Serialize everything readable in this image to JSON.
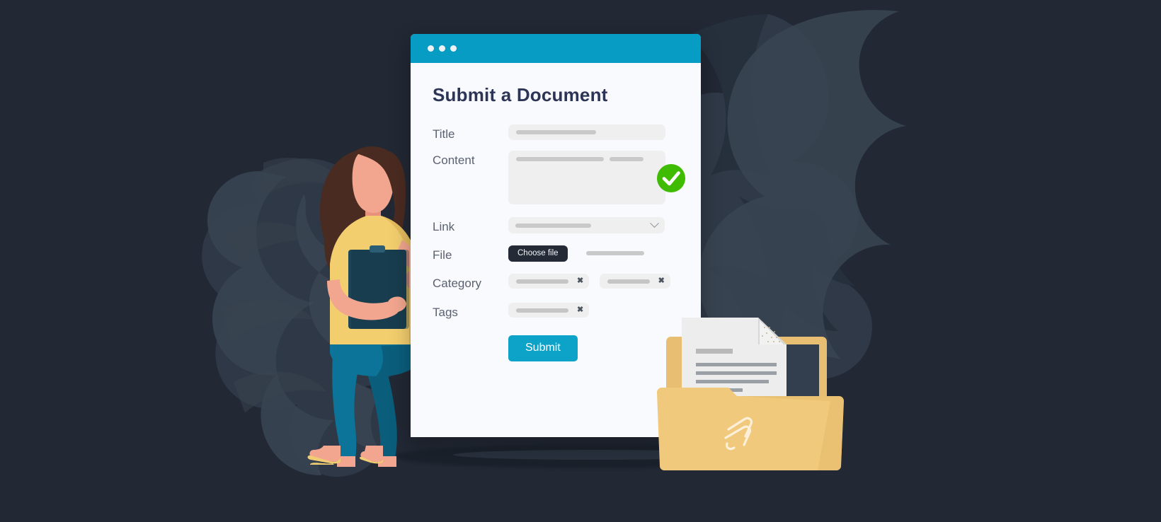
{
  "page": {
    "background_color": "#222834",
    "illustration_names": [
      "woman-with-clipboard",
      "document-folder",
      "monstera-leaf-left",
      "monstera-leaf-right"
    ]
  },
  "window": {
    "titlebar": {
      "color": "#069CC4",
      "dots": [
        "dot-1",
        "dot-2",
        "dot-3"
      ]
    },
    "background_color": "#F9FAFD",
    "heading": "Submit a Document"
  },
  "form": {
    "fields": [
      {
        "id": "title",
        "label": "Title",
        "type": "text",
        "value": "",
        "placeholder": ""
      },
      {
        "id": "content",
        "label": "Content",
        "type": "textarea",
        "value": "",
        "placeholder": ""
      },
      {
        "id": "link",
        "label": "Link",
        "type": "select",
        "value": "",
        "placeholder": ""
      },
      {
        "id": "file",
        "label": "File",
        "type": "file",
        "value": "",
        "placeholder": ""
      },
      {
        "id": "category",
        "label": "Category",
        "type": "tags",
        "value": "",
        "placeholder": ""
      },
      {
        "id": "tags",
        "label": "Tags",
        "type": "tags",
        "value": "",
        "placeholder": ""
      }
    ],
    "file_button_label": "Choose file",
    "category_chips": [
      {
        "remove_label": "✖"
      },
      {
        "remove_label": "✖"
      }
    ],
    "tags_chips": [
      {
        "remove_label": "✖"
      }
    ],
    "submit_label": "Submit",
    "submit_color": "#0DA2C8",
    "validation": {
      "content": {
        "state": "valid",
        "icon": "check-circle-icon",
        "color": "#3FBC00"
      }
    }
  },
  "colors": {
    "accent": "#069CC4",
    "submit": "#0DA2C8",
    "heading": "#2D3557",
    "label": "#5A6170",
    "field_fill": "#EFEFEF",
    "field_bar": "#C9C9C9",
    "dark_button": "#242A36",
    "success": "#3FBC00",
    "folder_yellow": "#F1C97C",
    "skin": "#F2A18B",
    "hair": "#4B2C22",
    "shirt": "#F3CE6F",
    "jeans": "#0C7498",
    "clipboard": "#1D4457"
  }
}
